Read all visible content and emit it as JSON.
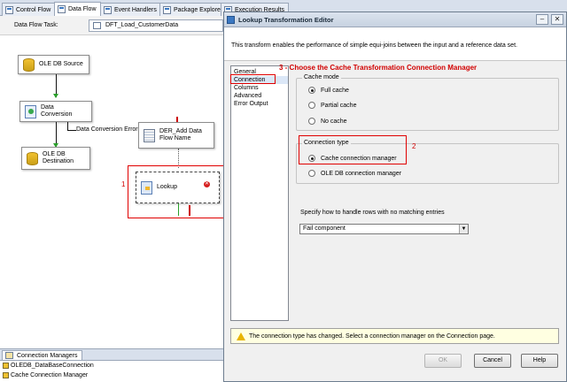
{
  "designer": {
    "tabs": [
      {
        "label": "Control Flow"
      },
      {
        "label": "Data Flow"
      },
      {
        "label": "Event Handlers"
      },
      {
        "label": "Package Explorer"
      },
      {
        "label": "Execution Results"
      }
    ],
    "task_label": "Data Flow Task:",
    "task_value": "DFT_Load_CustomerData",
    "nodes": {
      "ole_db_source": "OLE DB Source",
      "data_conversion": "Data Conversion",
      "der_add_data_flow_name": "DER_Add Data Flow Name",
      "ole_db_destination": "OLE DB Destination",
      "lookup": "Lookup"
    },
    "path_label": "Data Conversion Error O",
    "annotation_1": "1",
    "connection_managers": {
      "header": "Connection Managers",
      "items": [
        "OLEDB_DataBaseConnection",
        "Cache Connection Manager"
      ]
    }
  },
  "dialog": {
    "title": "Lookup Transformation Editor",
    "intro": "This transform enables the performance of simple equi-joins between the input and a reference data set.",
    "nav": [
      "General",
      "Connection",
      "Columns",
      "Advanced",
      "Error Output"
    ],
    "nav_selected": "Connection",
    "caption": "3 - Choose the Cache Transformation Connection Manager",
    "annotation_2": "2",
    "cache_mode": {
      "label": "Cache mode",
      "options": [
        "Full cache",
        "Partial cache",
        "No cache"
      ],
      "selected": "Full cache"
    },
    "connection_type": {
      "label": "Connection type",
      "options": [
        "Cache connection manager",
        "OLE DB connection manager"
      ],
      "selected": "Cache connection manager"
    },
    "no_match_label": "Specify how to handle rows with no matching entries",
    "no_match_value": "Fail component",
    "warning": "The connection type has changed. Select a connection manager on the Connection page.",
    "buttons": {
      "ok": "OK",
      "cancel": "Cancel",
      "help": "Help"
    },
    "window_buttons": {
      "minimize": "–",
      "close": "✕"
    }
  },
  "colors": {
    "annotation_red": "#e00000",
    "valid_path_green": "#2aa02a",
    "selection_highlight": "#dbe7f7",
    "warning_bg": "#ffffe1"
  }
}
